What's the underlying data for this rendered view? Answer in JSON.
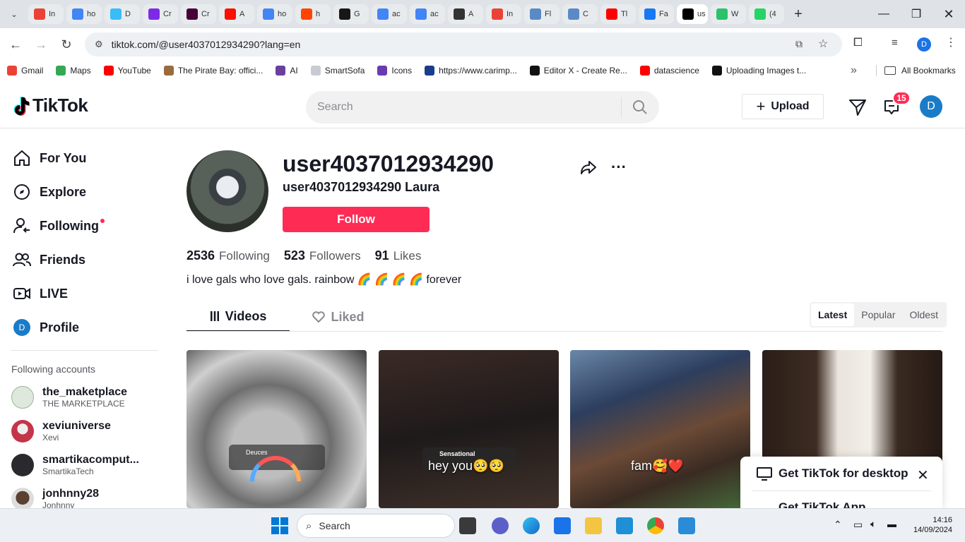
{
  "browser": {
    "tabs": [
      {
        "title": "In",
        "icon": "gmail-icon",
        "color": "#ea4335"
      },
      {
        "title": "ho",
        "icon": "google-icon",
        "color": "#4285f4"
      },
      {
        "title": "D",
        "icon": "tailwind-icon",
        "color": "#38bdf8"
      },
      {
        "title": "Cr",
        "icon": "canva-icon",
        "color": "#7d2ae8"
      },
      {
        "title": "Cr",
        "icon": "adobe-xd-icon",
        "color": "#470137"
      },
      {
        "title": "A",
        "icon": "adobe-icon",
        "color": "#fa0f00"
      },
      {
        "title": "ho",
        "icon": "google-icon",
        "color": "#4285f4"
      },
      {
        "title": "h",
        "icon": "reddit-icon",
        "color": "#ff4500"
      },
      {
        "title": "G",
        "icon": "github-icon",
        "color": "#181717"
      },
      {
        "title": "ac",
        "icon": "google-icon",
        "color": "#4285f4"
      },
      {
        "title": "ac",
        "icon": "google-icon",
        "color": "#4285f4"
      },
      {
        "title": "A",
        "icon": "car-icon",
        "color": "#333333"
      },
      {
        "title": "In",
        "icon": "gmail-icon",
        "color": "#ea4335"
      },
      {
        "title": "Fl",
        "icon": "figma-icon",
        "color": "#5a8ac6"
      },
      {
        "title": "C",
        "icon": "codepen-icon",
        "color": "#5a8ac6"
      },
      {
        "title": "Tl",
        "icon": "youtube-icon",
        "color": "#ff0000"
      },
      {
        "title": "Fa",
        "icon": "facebook-icon",
        "color": "#1877f2"
      },
      {
        "title": "us",
        "icon": "tiktok-icon",
        "color": "#000000",
        "active": true
      },
      {
        "title": "W",
        "icon": "play-icon",
        "color": "#2bc26b"
      },
      {
        "title": "(4",
        "icon": "whatsapp-icon",
        "color": "#25d366"
      }
    ],
    "url": "tiktok.com/@user4037012934290?lang=en",
    "bookmarks": [
      {
        "label": "Gmail",
        "color": "#ea4335"
      },
      {
        "label": "Maps",
        "color": "#34a853"
      },
      {
        "label": "YouTube",
        "color": "#ff0000"
      },
      {
        "label": "The Pirate Bay: offici...",
        "color": "#9b6b3d"
      },
      {
        "label": "AI",
        "color": "#6b3fa0"
      },
      {
        "label": "SmartSofa",
        "color": "#c8ccd2"
      },
      {
        "label": "Icons",
        "color": "#6a3ab2"
      },
      {
        "label": "https://www.carimp...",
        "color": "#1a3c8c"
      },
      {
        "label": "Editor X - Create Re...",
        "color": "#111111"
      },
      {
        "label": "datascience",
        "color": "#ff0000"
      },
      {
        "label": "Uploading Images t...",
        "color": "#111111"
      }
    ],
    "bookmarks_overflow": "»",
    "all_bookmarks": "All Bookmarks",
    "profile_initial": "D"
  },
  "tiktok": {
    "logo": "TikTok",
    "search_placeholder": "Search",
    "upload": "Upload",
    "inbox_count": "15",
    "avatar_initial": "D",
    "nav": [
      {
        "label": "For You",
        "icon": "home-icon"
      },
      {
        "label": "Explore",
        "icon": "compass-icon"
      },
      {
        "label": "Following",
        "icon": "following-icon"
      },
      {
        "label": "Friends",
        "icon": "friends-icon"
      },
      {
        "label": "LIVE",
        "icon": "live-icon"
      },
      {
        "label": "Profile",
        "icon": "profile-icon"
      }
    ],
    "following_title": "Following accounts",
    "following_accounts": [
      {
        "name": "the_maketplace",
        "sub": "THE MARKETPLACE",
        "color": "#dfe8dc"
      },
      {
        "name": "xeviuniverse",
        "sub": "Xevi",
        "color": "#c4344a"
      },
      {
        "name": "smartikacomput...",
        "sub": "SmartikaTech",
        "color": "#2a2a2e"
      },
      {
        "name": "jonhnny28",
        "sub": "Jonhnny",
        "color": "#4a3a30"
      }
    ],
    "profile": {
      "username": "user4037012934290",
      "nickname": "user4037012934290 Laura",
      "follow": "Follow",
      "following_count": "2536",
      "following_label": "Following",
      "followers_count": "523",
      "followers_label": "Followers",
      "likes_count": "91",
      "likes_label": "Likes",
      "bio": "i love gals who love gals. rainbow 🌈 🌈 🌈 🌈 forever"
    },
    "tabs": {
      "videos": "Videos",
      "liked": "Liked"
    },
    "sort": [
      "Latest",
      "Popular",
      "Oldest"
    ],
    "videos": [
      {
        "caption": "",
        "sticker": "Deuces"
      },
      {
        "caption": "hey you🥺🥺",
        "sticker": "Sensational"
      },
      {
        "caption": "fam🥰❤️",
        "sticker": ""
      },
      {
        "caption": "",
        "sticker": ""
      }
    ],
    "get_app": {
      "title": "Get TikTok for desktop",
      "subtitle": "Get TikTok App",
      "close": "✕"
    }
  },
  "taskbar": {
    "search": "Search",
    "time": "14:16",
    "date": "14/09/2024"
  }
}
